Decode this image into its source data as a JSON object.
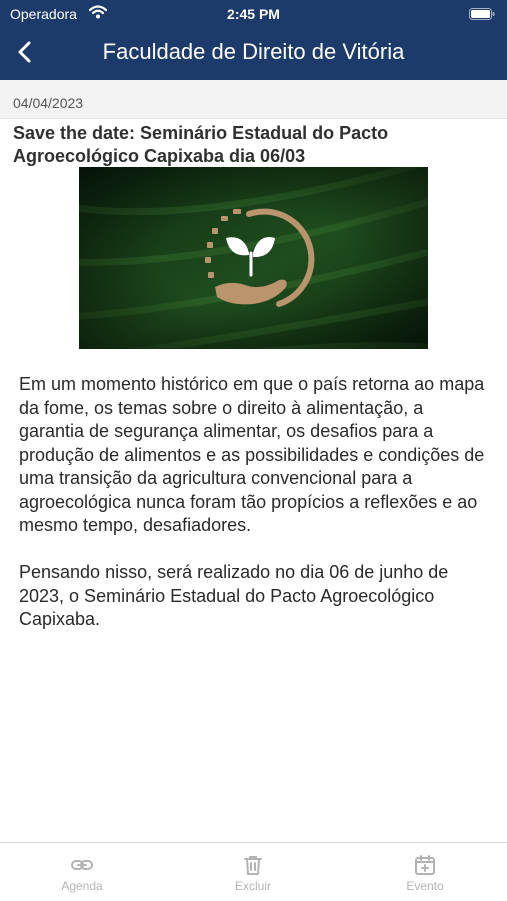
{
  "status_bar": {
    "carrier": "Operadora",
    "time": "2:45 PM"
  },
  "nav": {
    "title": "Faculdade de Direito de Vitória"
  },
  "article": {
    "date": "04/04/2023",
    "title": "Save the date: Seminário Estadual do Pacto Agroecológico Capixaba dia 06/03",
    "paragraphs": [
      "Em um momento histórico em que o país retorna ao mapa da fome, os temas sobre o direito à alimentação, a garantia de segurança alimentar, os desafios para a produção de alimentos e as possibilidades e condições de uma transição da agricultura convencional para a agroecológica nunca foram tão propícios a reflexões e ao mesmo tempo, desafiadores.",
      "Pensando nisso, será realizado no dia 06 de junho de 2023, o Seminário Estadual do Pacto Agroecológico Capixaba."
    ]
  },
  "tabbar": {
    "items": [
      {
        "label": "Agenda",
        "icon": "link-icon"
      },
      {
        "label": "Excluir",
        "icon": "trash-icon"
      },
      {
        "label": "Evento",
        "icon": "calendar-add-icon"
      }
    ]
  },
  "colors": {
    "nav_bg": "#1c3a6a",
    "tab_inactive": "#b3b3b3",
    "logo_gold": "#b9946c"
  }
}
